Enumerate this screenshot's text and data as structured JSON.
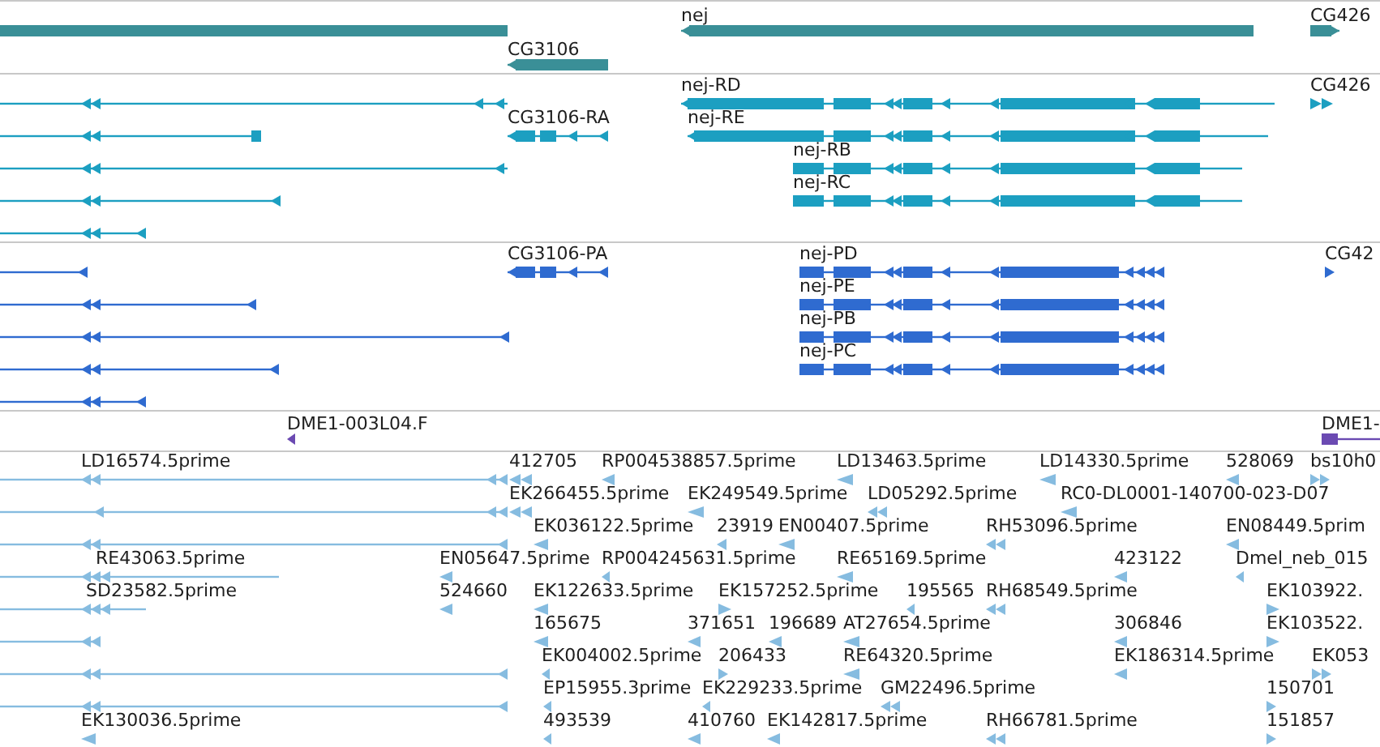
{
  "tracks": [
    {
      "kind": "gene",
      "features": [
        {
          "reverse_strand": true
        },
        {
          "label": "nej",
          "reverse_strand": true
        },
        {
          "label": "CG426",
          "reverse_strand": false
        },
        {
          "label": "CG3106",
          "reverse_strand": true
        }
      ]
    },
    {
      "kind": "transcript",
      "features": [
        {
          "reverse_strand": true
        },
        {
          "reverse_strand": true
        },
        {
          "reverse_strand": true
        },
        {
          "reverse_strand": true
        },
        {
          "reverse_strand": true
        },
        {
          "label": "nej-RD",
          "reverse_strand": true
        },
        {
          "label": "CG426",
          "reverse_strand": false
        },
        {
          "label": "CG3106-RA",
          "reverse_strand": true
        },
        {
          "label": "nej-RE",
          "reverse_strand": true
        },
        {
          "label": "nej-RB",
          "reverse_strand": true
        },
        {
          "label": "nej-RC",
          "reverse_strand": true
        }
      ]
    },
    {
      "kind": "protein",
      "features": [
        {
          "reverse_strand": true
        },
        {
          "reverse_strand": true
        },
        {
          "reverse_strand": true
        },
        {
          "reverse_strand": true
        },
        {
          "reverse_strand": true
        },
        {
          "label": "CG3106-PA",
          "reverse_strand": true
        },
        {
          "label": "nej-PD",
          "reverse_strand": true
        },
        {
          "label": "CG42",
          "reverse_strand": false
        },
        {
          "label": "nej-PE",
          "reverse_strand": true
        },
        {
          "label": "nej-PB",
          "reverse_strand": true
        },
        {
          "label": "nej-PC",
          "reverse_strand": true
        }
      ]
    },
    {
      "kind": "clone",
      "features": [
        {
          "label": "DME1-003L04.F",
          "reverse_strand": true
        },
        {
          "label": "DME1-",
          "reverse_strand": true
        }
      ]
    },
    {
      "kind": "est",
      "features": [
        {
          "reverse_strand": true
        },
        {
          "reverse_strand": true
        },
        {
          "reverse_strand": true
        },
        {
          "reverse_strand": true
        },
        {
          "reverse_strand": true
        },
        {
          "reverse_strand": true
        },
        {
          "reverse_strand": true
        },
        {
          "reverse_strand": true
        },
        {
          "label": "LD16574.5prime",
          "reverse_strand": true
        },
        {
          "label": "412705",
          "reverse_strand": true
        },
        {
          "label": "RP004538857.5prime",
          "reverse_strand": true
        },
        {
          "label": "LD13463.5prime",
          "reverse_strand": true
        },
        {
          "label": "LD14330.5prime",
          "reverse_strand": true
        },
        {
          "label": "528069",
          "reverse_strand": true
        },
        {
          "label": "bs10h0",
          "reverse_strand": false
        },
        {
          "label": "EK266455.5prime",
          "reverse_strand": true
        },
        {
          "label": "EK249549.5prime",
          "reverse_strand": true
        },
        {
          "label": "LD05292.5prime",
          "reverse_strand": true
        },
        {
          "label": "RC0-DL0001-140700-023-D07",
          "reverse_strand": true
        },
        {
          "label": "EK036122.5prime",
          "reverse_strand": true
        },
        {
          "label": "23919",
          "reverse_strand": true
        },
        {
          "label": "EN00407.5prime",
          "reverse_strand": true
        },
        {
          "label": "RH53096.5prime",
          "reverse_strand": true
        },
        {
          "label": "EN08449.5prim",
          "reverse_strand": true
        },
        {
          "label": "RE43063.5prime",
          "reverse_strand": true
        },
        {
          "label": "EN05647.5prime",
          "reverse_strand": true
        },
        {
          "label": "RP004245631.5prime",
          "reverse_strand": true
        },
        {
          "label": "RE65169.5prime",
          "reverse_strand": true
        },
        {
          "label": "423122",
          "reverse_strand": true
        },
        {
          "label": "Dmel_neb_015",
          "reverse_strand": true
        },
        {
          "label": "SD23582.5prime",
          "reverse_strand": true
        },
        {
          "label": "524660",
          "reverse_strand": true
        },
        {
          "label": "EK122633.5prime",
          "reverse_strand": true
        },
        {
          "label": "EK157252.5prime",
          "reverse_strand": false
        },
        {
          "label": "195565",
          "reverse_strand": true
        },
        {
          "label": "RH68549.5prime",
          "reverse_strand": true
        },
        {
          "label": "EK103922.",
          "reverse_strand": false
        },
        {
          "label": "165675",
          "reverse_strand": true
        },
        {
          "label": "371651",
          "reverse_strand": true
        },
        {
          "label": "196689",
          "reverse_strand": true
        },
        {
          "label": "AT27654.5prime",
          "reverse_strand": true
        },
        {
          "label": "306846",
          "reverse_strand": true
        },
        {
          "label": "EK103522.",
          "reverse_strand": false
        },
        {
          "label": "EK004002.5prime",
          "reverse_strand": true
        },
        {
          "label": "206433",
          "reverse_strand": false
        },
        {
          "label": "RE64320.5prime",
          "reverse_strand": true
        },
        {
          "label": "EK186314.5prime",
          "reverse_strand": true
        },
        {
          "label": "EK053",
          "reverse_strand": false
        },
        {
          "label": "EP15955.3prime",
          "reverse_strand": true
        },
        {
          "label": "EK229233.5prime",
          "reverse_strand": true
        },
        {
          "label": "GM22496.5prime",
          "reverse_strand": true
        },
        {
          "label": "150701",
          "reverse_strand": false
        },
        {
          "label": "EK130036.5prime",
          "reverse_strand": true
        },
        {
          "label": "493539",
          "reverse_strand": true
        },
        {
          "label": "410760",
          "reverse_strand": true
        },
        {
          "label": "EK142817.5prime",
          "reverse_strand": true
        },
        {
          "label": "RH66781.5prime",
          "reverse_strand": true
        },
        {
          "label": "151857",
          "reverse_strand": false
        }
      ]
    }
  ]
}
